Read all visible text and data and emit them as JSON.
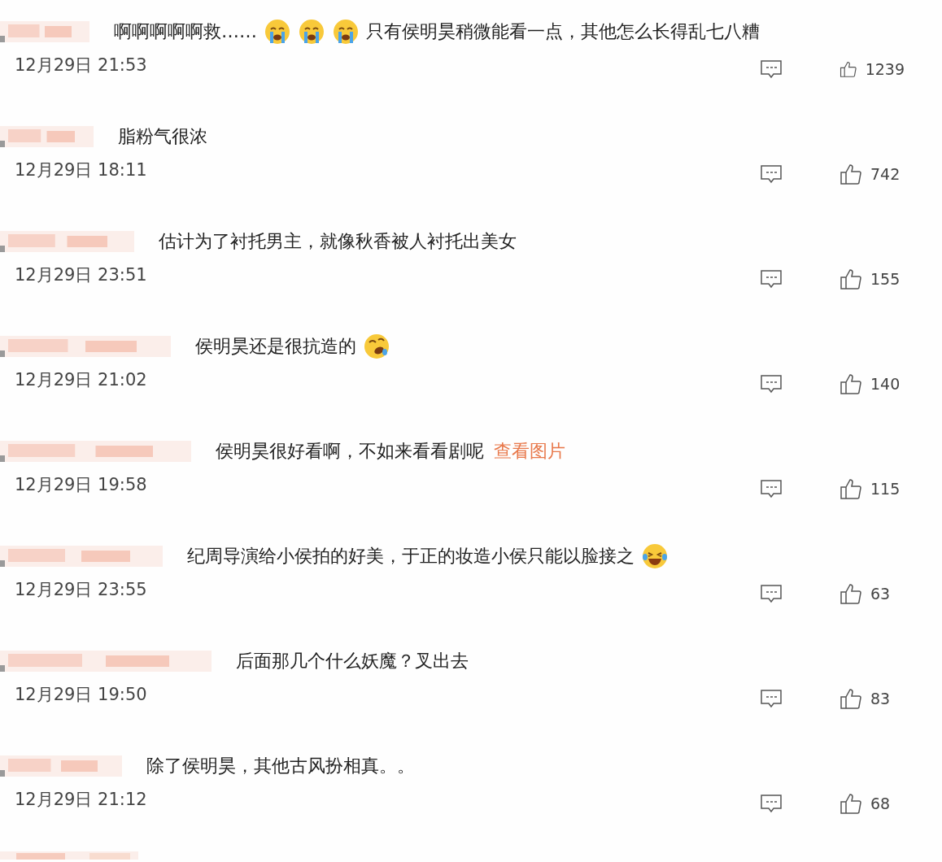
{
  "comments": [
    {
      "content": [
        {
          "kind": "text",
          "text": "啊啊啊啊啊救……"
        },
        {
          "kind": "crying"
        },
        {
          "kind": "crying"
        },
        {
          "kind": "crying"
        },
        {
          "kind": "text",
          "text": "只有侯明昊稍微能看一点，其他怎么长得乱七八糟"
        }
      ],
      "time": "12月29日 21:53",
      "likes": "1239"
    },
    {
      "content": [
        {
          "kind": "text",
          "text": "脂粉气很浓"
        }
      ],
      "time": "12月29日 18:11",
      "likes": "742"
    },
    {
      "content": [
        {
          "kind": "text",
          "text": "估计为了衬托男主，就像秋香被人衬托出美女"
        }
      ],
      "time": "12月29日 23:51",
      "likes": "155"
    },
    {
      "content": [
        {
          "kind": "text",
          "text": "侯明昊还是很抗造的"
        },
        {
          "kind": "rolling"
        }
      ],
      "time": "12月29日 21:02",
      "likes": "140"
    },
    {
      "content": [
        {
          "kind": "text",
          "text": "侯明昊很好看啊，不如来看看剧呢"
        },
        {
          "kind": "link",
          "text": "查看图片"
        }
      ],
      "time": "12月29日 19:58",
      "likes": "115"
    },
    {
      "content": [
        {
          "kind": "text",
          "text": "纪周导演给小侯拍的好美，于正的妆造小侯只能以脸接之"
        },
        {
          "kind": "laughing"
        }
      ],
      "time": "12月29日 23:55",
      "likes": "63"
    },
    {
      "content": [
        {
          "kind": "text",
          "text": "后面那几个什么妖魔？叉出去"
        }
      ],
      "time": "12月29日 19:50",
      "likes": "83"
    },
    {
      "content": [
        {
          "kind": "text",
          "text": "除了侯明昊，其他古风扮相真。。"
        }
      ],
      "time": "12月29日 21:12",
      "likes": "68"
    }
  ]
}
